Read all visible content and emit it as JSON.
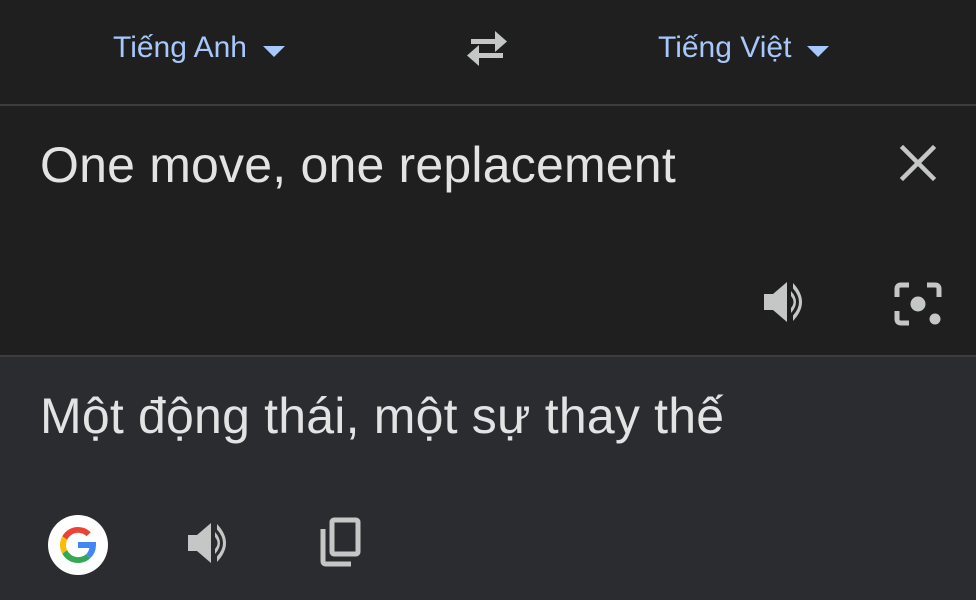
{
  "language_bar": {
    "source_language": "Tiếng Anh",
    "target_language": "Tiếng Việt",
    "swap_icon": "swap-arrows-icon",
    "dropdown_icon": "caret-down-icon"
  },
  "source": {
    "text": "One move, one replacement",
    "clear_icon": "close-icon",
    "listen_icon": "speaker-icon",
    "camera_icon": "lens-camera-icon"
  },
  "translation": {
    "text": "Một động thái, một sự thay thế",
    "google_icon": "google-logo-icon",
    "listen_icon": "speaker-icon",
    "copy_icon": "copy-icon"
  },
  "colors": {
    "accent": "#a8c7fa",
    "background": "#1f1f1f",
    "translation_background": "#2b2c30",
    "text": "#e3e3e3",
    "icon": "#c4c7c5"
  }
}
